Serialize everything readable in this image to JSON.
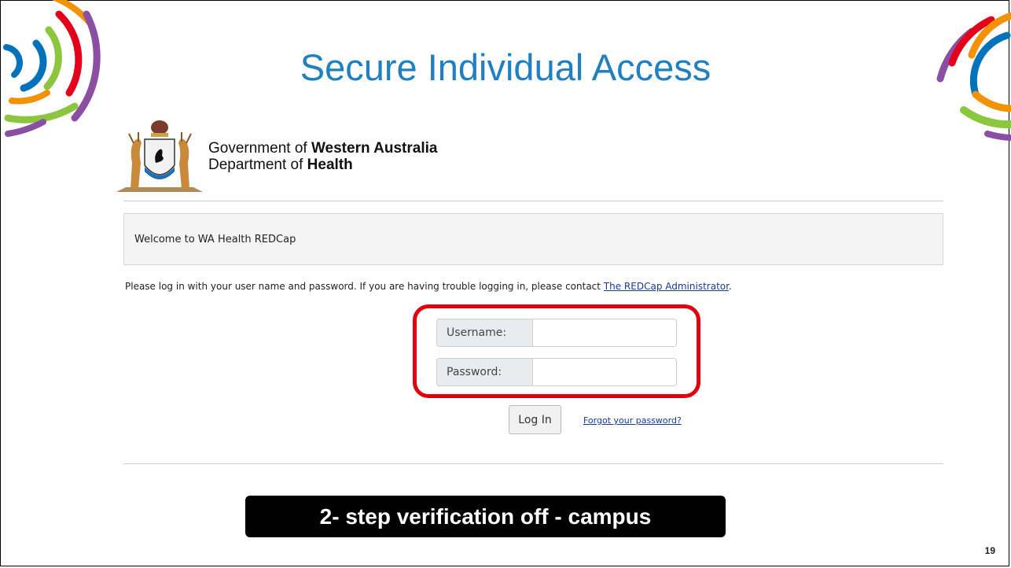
{
  "slide": {
    "title": "Secure Individual Access",
    "page_number": "19",
    "banner": "2- step verification off - campus"
  },
  "header": {
    "org_line1_prefix": "Government of ",
    "org_line1_bold": "Western Australia",
    "org_line2_prefix": "Department of ",
    "org_line2_bold": "Health",
    "crest_icon": "coat-of-arms-icon"
  },
  "welcome": {
    "text": "Welcome to WA Health REDCap"
  },
  "instructions": {
    "text": "Please log in with your user name and password. If you are having trouble logging in, please contact ",
    "link": "The REDCap Administrator",
    "suffix": "."
  },
  "login": {
    "username_label": "Username:",
    "username_value": "",
    "password_label": "Password:",
    "password_value": "",
    "button_label": "Log In",
    "forgot_link": "Forgot your password?"
  },
  "colors": {
    "title": "#1f7fc1",
    "highlight": "#e2000f",
    "arc_purple": "#8a4fa3",
    "arc_red": "#e2001a",
    "arc_orange": "#f39200",
    "arc_green": "#8cc63f",
    "arc_blue": "#0072bc"
  }
}
